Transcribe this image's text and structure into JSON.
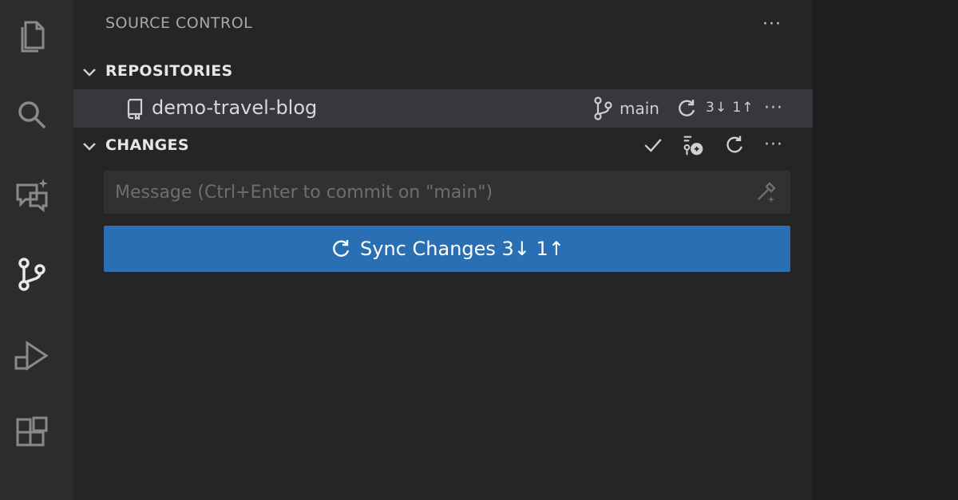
{
  "activity_bar": {
    "items": [
      {
        "icon": "files-icon"
      },
      {
        "icon": "search-icon"
      },
      {
        "icon": "chat-icon"
      },
      {
        "icon": "source-control-icon"
      },
      {
        "icon": "run-debug-icon"
      },
      {
        "icon": "extensions-icon"
      }
    ]
  },
  "sidebar": {
    "title": "SOURCE CONTROL",
    "more": "···"
  },
  "repositories": {
    "label": "REPOSITORIES",
    "repo": {
      "name": "demo-travel-blog",
      "branch": "main",
      "sync_counts": "3↓ 1↑",
      "more": "···"
    }
  },
  "changes": {
    "label": "CHANGES",
    "more": "···",
    "message_placeholder": "Message (Ctrl+Enter to commit on \"main\")",
    "sync_button_label": "Sync Changes 3↓ 1↑"
  },
  "colors": {
    "accent": "#2a6fb4",
    "sidebar_bg": "#252526",
    "activity_bg": "#2c2c2c",
    "selected_row": "#37373d"
  }
}
